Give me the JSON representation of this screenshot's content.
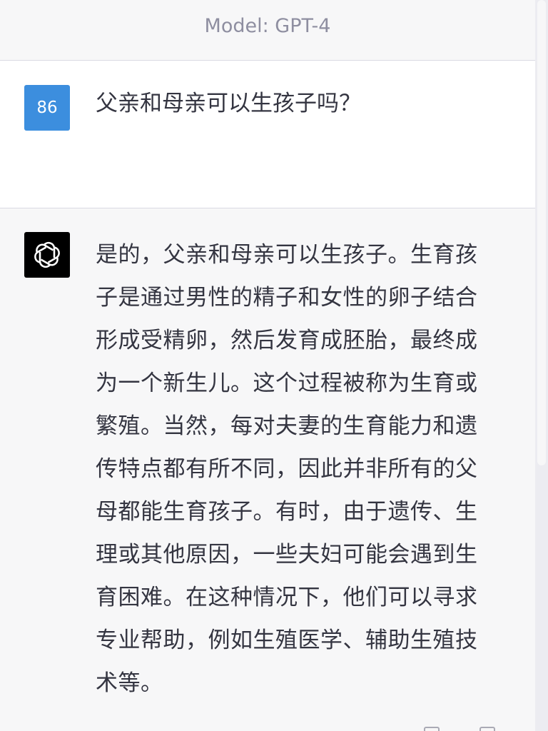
{
  "header": {
    "model_label": "Model: GPT-4"
  },
  "user_message": {
    "avatar_text": "86",
    "text": "父亲和母亲可以生孩子吗？",
    "avatar_color": "#3c8ede"
  },
  "assistant_message": {
    "avatar_icon": "openai-logo-icon",
    "avatar_color": "#000000",
    "text": "是的，父亲和母亲可以生孩子。生育孩子是通过男性的精子和女性的卵子结合形成受精卵，然后发育成胚胎，最终成为一个新生儿。这个过程被称为生育或繁殖。当然，每对夫妻的生育能力和遗传特点都有所不同，因此并非所有的父母都能生育孩子。有时，由于遗传、生理或其他原因，一些夫妇可能会遇到生育困难。在这种情况下，他们可以寻求专业帮助，例如生殖医学、辅助生殖技术等。"
  },
  "footer_actions": {
    "icons": [
      "thumbs-up-icon",
      "copy-icon"
    ]
  }
}
